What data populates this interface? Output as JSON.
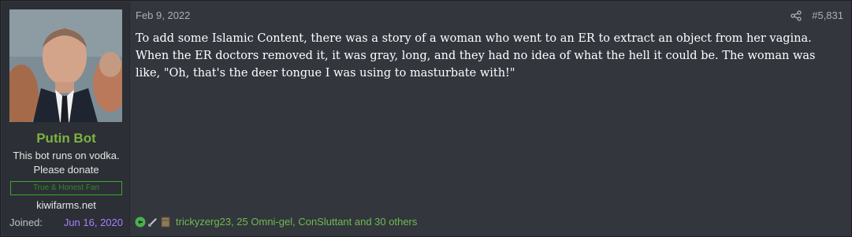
{
  "post": {
    "date": "Feb 9, 2022",
    "number": "#5,831",
    "body": "To add some Islamic Content, there was a story of a woman who went to an ER to extract an object from her vagina. When the ER doctors removed it, it was gray, long, and they had no idea of what the hell it could be. The woman was like, \"Oh, that's the deer tongue I was using to masturbate with!\"",
    "reactions_text": "trickyzerg23, 25 Omni-gel, ConSluttant and 30 others"
  },
  "user": {
    "name": "Putin Bot",
    "title_line1": "This bot runs on vodka.",
    "title_line2": "Please donate",
    "banner": "True & Honest Fan",
    "site": "kiwifarms.net",
    "joined_label": "Joined:",
    "joined_date": "Jun 16, 2020"
  },
  "icons": {
    "share": "share-icon",
    "reaction1": "reaction-icon-green",
    "reaction2": "reaction-icon-tool",
    "reaction3": "reaction-icon-box"
  },
  "colors": {
    "username": "#7cb342",
    "joined_date": "#a580ff",
    "reactions": "#6dbb4f",
    "banner_border": "#3fa535"
  }
}
